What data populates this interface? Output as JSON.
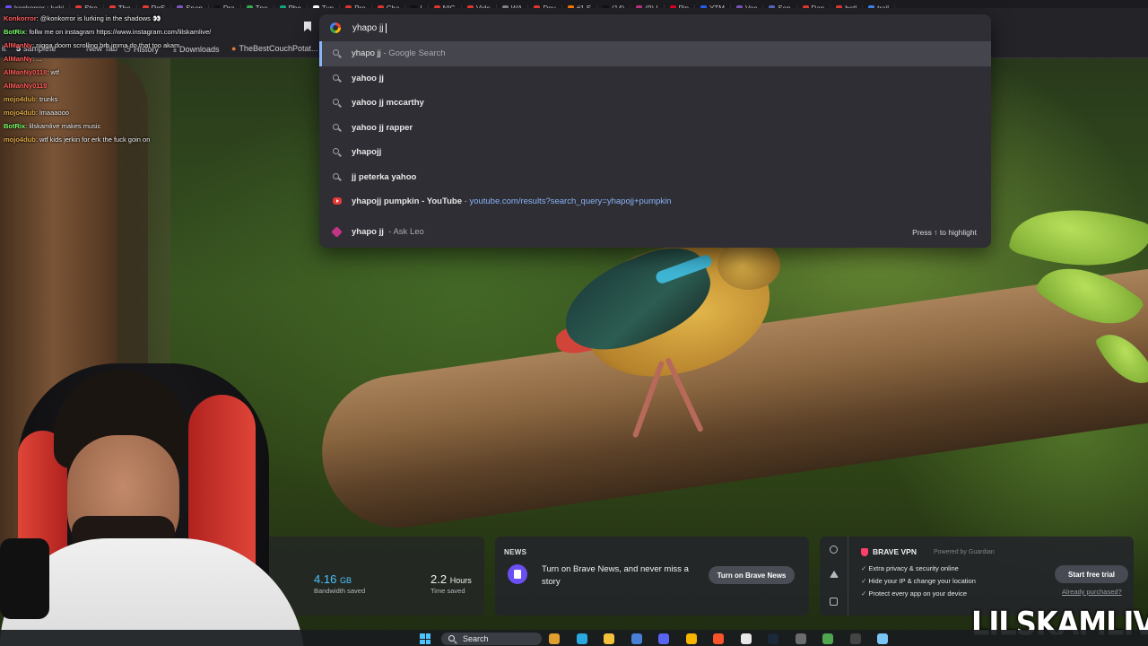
{
  "tabs": [
    {
      "label": "konkorror : lurki",
      "color": "#6b4ff5"
    },
    {
      "label": "Stre",
      "color": "#e53935"
    },
    {
      "label": "The",
      "color": "#e53935"
    },
    {
      "label": "RgS",
      "color": "#e53935"
    },
    {
      "label": "Snap",
      "color": "#7e57c2"
    },
    {
      "label": "Dra",
      "color": "#111111"
    },
    {
      "label": "Tpe",
      "color": "#34a853"
    },
    {
      "label": "Pho",
      "color": "#10a37f"
    },
    {
      "label": "Tun",
      "color": "#ffffff"
    },
    {
      "label": "Pro",
      "color": "#e53935"
    },
    {
      "label": "Cha",
      "color": "#e53935"
    },
    {
      "label": "I",
      "color": "#111111"
    },
    {
      "label": "NIG",
      "color": "#e53935"
    },
    {
      "label": "Vide",
      "color": "#e53935"
    },
    {
      "label": "WA",
      "color": "#888888"
    },
    {
      "label": "Dov",
      "color": "#e53935"
    },
    {
      "label": "#1 S",
      "color": "#ff7a00"
    },
    {
      "label": "(14)",
      "color": "#111111"
    },
    {
      "label": "(9) I",
      "color": "#c13584"
    },
    {
      "label": "Pin",
      "color": "#e60023"
    },
    {
      "label": "YTM",
      "color": "#2962ff"
    },
    {
      "label": "Voc",
      "color": "#7e57c2"
    },
    {
      "label": "Son",
      "color": "#5c6bc0"
    },
    {
      "label": "Dan",
      "color": "#e53935"
    },
    {
      "label": "betl",
      "color": "#e53935"
    },
    {
      "label": "trail",
      "color": "#4285f4"
    }
  ],
  "bookmarks": [
    {
      "label": "it"
    },
    {
      "label": "samplete"
    },
    {
      "label": "New Tab"
    },
    {
      "label": "History"
    },
    {
      "label": "Downloads"
    },
    {
      "label": "TheBestCouchPotat..."
    }
  ],
  "omnibox": {
    "query": "yhapo jj",
    "hint": "Press ↑ to highlight",
    "suggestions": [
      {
        "text": "yhapo jj",
        "suffix": " - Google Search",
        "icon": "search-icon",
        "selected": true
      },
      {
        "text": "yahoo jj",
        "suffix": "",
        "icon": "search-icon",
        "selected": false
      },
      {
        "text": "yahoo jj mccarthy",
        "suffix": "",
        "icon": "search-icon",
        "selected": false
      },
      {
        "text": "yahoo jj rapper",
        "suffix": "",
        "icon": "search-icon",
        "selected": false
      },
      {
        "text": "yhapojj",
        "suffix": "",
        "icon": "search-icon",
        "selected": false
      },
      {
        "text": "jj peterka yahoo",
        "suffix": "",
        "icon": "search-icon",
        "selected": false
      },
      {
        "text": "yhapojj pumpkin - YouTube",
        "suffix": " - ",
        "url": "youtube.com/results?search_query=yhapojj+pumpkin",
        "icon": "youtube-icon",
        "selected": false
      },
      {
        "text": "yhapo jj",
        "suffix": "  - Ask Leo",
        "icon": "ask-leo-icon",
        "selected": false
      }
    ]
  },
  "chat": [
    {
      "user": "Konkorror",
      "text": ": @konkorror is lurking in the shadows 👀",
      "color": "#ff5a5a"
    },
    {
      "user": "BotRix",
      "text": ": follw me on instagram https://www.instagram.com/lilskamlive/",
      "color": "#7dff6b"
    },
    {
      "user": "AlManNy",
      "text": ": nigga doom scrolling brb imma do that too akam",
      "color": "#ff5a5a"
    },
    {
      "user": "AlManNy",
      "text": ": ...",
      "color": "#ff5a5a"
    },
    {
      "user": "AlManNy0118",
      "text": ": wtf",
      "color": "#ff5a5a"
    },
    {
      "user": "AlManNy0118",
      "text": "",
      "color": "#ff5a5a"
    },
    {
      "user": "mojo4dub",
      "text": ": trunks",
      "color": "#d9a441"
    },
    {
      "user": "mojo4dub",
      "text": ": lmaaaooo",
      "color": "#d9a441"
    },
    {
      "user": "BotRix",
      "text": ": lilskamlive makes music",
      "color": "#7dff6b"
    },
    {
      "user": "mojo4dub",
      "text": ": wtf kids jerkin for erk the fuck goin on",
      "color": "#d9a441"
    }
  ],
  "stats": {
    "bandwidth_value": "4.16",
    "bandwidth_unit": "GB",
    "bandwidth_label": "Bandwidth saved",
    "time_value": "2.2",
    "time_unit": "Hours",
    "time_label": "Time saved"
  },
  "news": {
    "heading": "NEWS",
    "text": "Turn on Brave News, and never miss a story",
    "button": "Turn on Brave News"
  },
  "vpn": {
    "title": "BRAVE VPN",
    "powered": "Powered by Guardian",
    "features": [
      "Extra privacy & security online",
      "Hide your IP & change your location",
      "Protect every app on your device"
    ],
    "button": "Start free trial",
    "link": "Already purchased?"
  },
  "watermark": "LILSKAMLIVE",
  "taskbar": {
    "search_label": "Search",
    "apps": [
      {
        "name": "file-manager-icon",
        "color": "#e0a030"
      },
      {
        "name": "edge-icon",
        "color": "#2aa8e0"
      },
      {
        "name": "folder-icon",
        "color": "#f3c13a"
      },
      {
        "name": "store-icon",
        "color": "#4a7fd8"
      },
      {
        "name": "discord-icon",
        "color": "#5865f2"
      },
      {
        "name": "app-icon",
        "color": "#f7b500"
      },
      {
        "name": "brave-icon",
        "color": "#fb542b"
      },
      {
        "name": "chrome-icon",
        "color": "#e8e8e8"
      },
      {
        "name": "steam-icon",
        "color": "#1b2838"
      },
      {
        "name": "app-icon",
        "color": "#6c6c6c"
      },
      {
        "name": "app-icon",
        "color": "#4fa64f"
      },
      {
        "name": "4k-icon",
        "color": "#444444"
      },
      {
        "name": "notepad-icon",
        "color": "#7ac6f5"
      }
    ]
  }
}
